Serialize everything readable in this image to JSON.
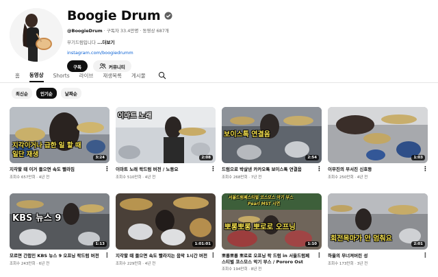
{
  "channel": {
    "name": "Boogie Drum",
    "handle": "@BoogieDrum",
    "stats": " · 구독자 33.4만명 · 동영상 687개",
    "description": "부기드럼입니다",
    "more_label": " ...더보기",
    "link": "instagram.com/boogiedrumm",
    "subscribe_label": "구독",
    "members_label": "커뮤니티"
  },
  "tabs": [
    {
      "label": "홈"
    },
    {
      "label": "동영상"
    },
    {
      "label": "Shorts"
    },
    {
      "label": "라이브"
    },
    {
      "label": "재생목록"
    },
    {
      "label": "게시물"
    }
  ],
  "chips": [
    {
      "label": "최신순"
    },
    {
      "label": "인기순"
    },
    {
      "label": "날짜순"
    }
  ],
  "videos": [
    {
      "title": "지각할 때 이거 들으면 속도 빨라짐",
      "views": "조회수 657만회",
      "age": "4년 전",
      "duration": "3:24",
      "overlay": [
        "지각이거나 급한 일 할 때",
        "일단 재생"
      ]
    },
    {
      "title": "이마트 노래 락드럼 버전 / 노동요",
      "views": "조회수 510만회",
      "age": "4년 전",
      "duration": "2:08",
      "overlay": [
        "이마트 노래"
      ]
    },
    {
      "title": "드럼으로 박살낸 카카오톡 보이스톡 연결음",
      "views": "조회수 268만회",
      "age": "7년 전",
      "duration": "2:54",
      "overlay": [
        "보이스톡 연결음"
      ]
    },
    {
      "title": "이무진의 부서진 신호등",
      "views": "조회수 250만회",
      "age": "4년 전",
      "duration": "1:03",
      "overlay": []
    },
    {
      "title": "모르면 간첩인 KBS 뉴스 9 오프닝 락드럼 버전",
      "views": "조회수 243만회",
      "age": "6년 전",
      "duration": "1:13",
      "overlay": [
        "KBS 뉴스 9"
      ]
    },
    {
      "title": "지각할 때 들으면 속도 빨라지는 음악 1시간 버전",
      "views": "조회수 229만회",
      "age": "4년 전",
      "duration": "1:01:01",
      "overlay": []
    },
    {
      "title": "뽀롱뽀롱 뽀로로 오프닝 락 드럼 in 서울드럼페스티벌 코스모스 악기 부스 / Pororo Ost Rock...",
      "views": "조회수 194만회",
      "age": "8년 전",
      "duration": "1:10",
      "overlay": [
        "뽀롱뽀롱 뽀로로 오프닝"
      ],
      "overlay_small": [
        "서울드럼페스티벌 코스모스 악기 부스",
        "Pearl MST 시연"
      ]
    },
    {
      "title": "하울의 무너져버린 성",
      "views": "조회수 173만회",
      "age": "3년 전",
      "duration": "2:01",
      "overlay": [
        "회전목마가 안 멈춰요"
      ]
    }
  ],
  "colors": {
    "link": "#065fd4",
    "muted": "#606060",
    "overlay_yellow": "#f4e04d",
    "overlay_white": "#ffffff"
  },
  "icons": [
    "verified-icon",
    "people-icon",
    "search-icon",
    "kebab-icon"
  ]
}
